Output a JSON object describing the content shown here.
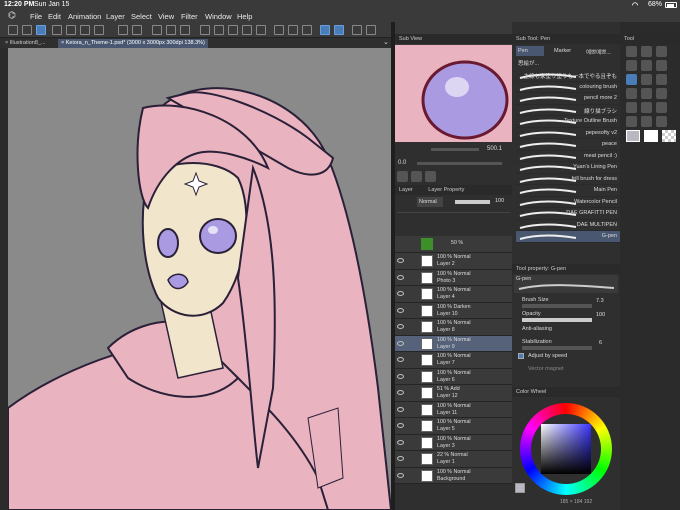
{
  "status": {
    "time": "12:20 PM",
    "date": "Sun Jan 15",
    "battery": "68%"
  },
  "menu": {
    "file": "File",
    "edit": "Edit",
    "animation": "Animation",
    "layer": "Layer",
    "select": "Select",
    "view": "View",
    "filter": "Filter",
    "window": "Window",
    "help": "Help"
  },
  "tabs": [
    {
      "label": "Illustration8_..."
    },
    {
      "label": "Keiora_n_Theme-1.psd* (3000 x 3000px 300dpi 138.3%)"
    }
  ],
  "subview": {
    "label": "Sub View"
  },
  "navigator": {
    "zoom": "500.1",
    "angle": "0.0"
  },
  "layer_panel": {
    "tab_layer": "Layer",
    "tab_property": "Layer Property",
    "blend_mode": "Normal",
    "opacity": "100",
    "top_layer": {
      "line1": "50 %"
    },
    "layers": [
      {
        "line1": "100 %  Normal",
        "line2": "Layer 2",
        "selected": false
      },
      {
        "line1": "100 %  Normal",
        "line2": "Photo 3",
        "selected": false
      },
      {
        "line1": "100 %  Normal",
        "line2": "Layer 4",
        "selected": false
      },
      {
        "line1": "100 %  Darken",
        "line2": "Layer 10",
        "selected": false
      },
      {
        "line1": "100 %  Normal",
        "line2": "Layer 8",
        "selected": false
      },
      {
        "line1": "100 %  Normal",
        "line2": "Layer 9",
        "selected": true
      },
      {
        "line1": "100 %  Normal",
        "line2": "Layer 7",
        "selected": false
      },
      {
        "line1": "100 %  Normal",
        "line2": "Layer 6",
        "selected": false
      },
      {
        "line1": "51 %  Add",
        "line2": "Layer 12",
        "selected": false
      },
      {
        "line1": "100 %  Normal",
        "line2": "Layer 11",
        "selected": false
      },
      {
        "line1": "100 %  Normal",
        "line2": "Layer 5",
        "selected": false
      },
      {
        "line1": "100 %  Normal",
        "line2": "Layer 3",
        "selected": false
      },
      {
        "line1": "22 %  Normal",
        "line2": "Layer 1",
        "selected": false
      },
      {
        "line1": "100 %  Normal",
        "line2": "Background",
        "selected": false
      }
    ]
  },
  "subtool": {
    "header": "Sub Tool: Pen",
    "tab_pen": "Pen",
    "tab_marker": "Marker",
    "tab_other": "예쁘예쁘...",
    "tab_extra": "思絵が...",
    "brushes": [
      {
        "name": "主線も家塗り塗りも一本でやる且ぞも",
        "selected": false
      },
      {
        "name": "colouring brush",
        "selected": false
      },
      {
        "name": "pencil more 2",
        "selected": false
      },
      {
        "name": "線り描ブラシ",
        "selected": false
      },
      {
        "name": "Texture Outline Brush",
        "selected": false
      },
      {
        "name": "pepesofty v2",
        "selected": false
      },
      {
        "name": "peace",
        "selected": false
      },
      {
        "name": "meat pencil :)",
        "selected": false
      },
      {
        "name": "Yuan's Lining Pen",
        "selected": false
      },
      {
        "name": "frill brush for dress",
        "selected": false
      },
      {
        "name": "Main Pen",
        "selected": false
      },
      {
        "name": "Watercolor Pencil",
        "selected": false
      },
      {
        "name": "DAE GRAFITTI PEN",
        "selected": false
      },
      {
        "name": "DAE MULTIPEN",
        "selected": false
      },
      {
        "name": "G-pen",
        "selected": true
      }
    ]
  },
  "tool_property": {
    "header": "Tool property: G-pen",
    "preview_label": "G-pen",
    "brush_size_label": "Brush Size",
    "brush_size_value": "7.3",
    "opacity_label": "Opacity",
    "opacity_value": "100",
    "antialias_label": "Anti-aliasing",
    "stabilization_label": "Stabilization",
    "stabilization_value": "6",
    "adjust_label": "Adjust by speed",
    "vector_label": "Vector magnet"
  },
  "color_wheel": {
    "header": "Color Wheel",
    "rgb": "185 × 184  192"
  },
  "tool_panel": {
    "header": "Tool"
  },
  "colors": {
    "accent": "#4a7db8",
    "hair": "#e8b4be",
    "skin": "#f0e4cc",
    "eye": "#a89ae0",
    "canvas_bg": "#8a8a8a"
  }
}
